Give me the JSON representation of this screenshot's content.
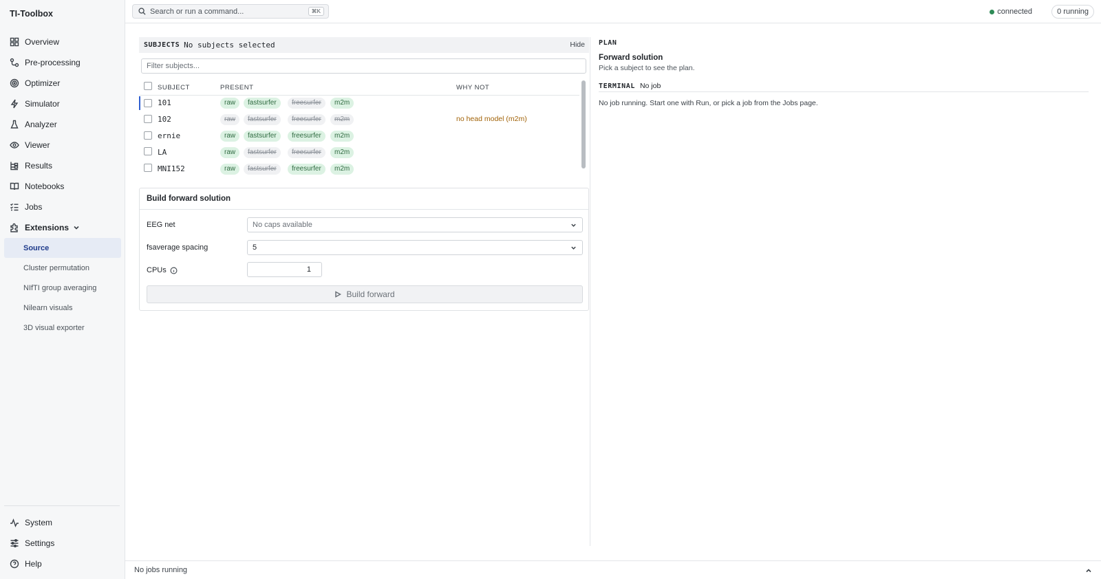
{
  "app": {
    "title": "TI-Toolbox"
  },
  "search": {
    "placeholder": "Search or run a command...",
    "shortcut": "⌘K"
  },
  "status": {
    "connection": "connected",
    "running": "0 running"
  },
  "sidebar": {
    "items": [
      {
        "label": "Overview",
        "icon": "grid-icon"
      },
      {
        "label": "Pre-processing",
        "icon": "workflow-icon"
      },
      {
        "label": "Optimizer",
        "icon": "target-icon"
      },
      {
        "label": "Simulator",
        "icon": "bolt-icon"
      },
      {
        "label": "Analyzer",
        "icon": "flask-icon"
      },
      {
        "label": "Viewer",
        "icon": "eye-icon"
      },
      {
        "label": "Results",
        "icon": "tree-icon"
      },
      {
        "label": "Notebooks",
        "icon": "book-icon"
      },
      {
        "label": "Jobs",
        "icon": "checklist-icon"
      },
      {
        "label": "Extensions",
        "icon": "puzzle-icon"
      }
    ],
    "extensions": [
      "Source",
      "Cluster permutation",
      "NIfTI group averaging",
      "Nilearn visuals",
      "3D visual exporter"
    ],
    "bottom": [
      {
        "label": "System",
        "icon": "activity-icon"
      },
      {
        "label": "Settings",
        "icon": "sliders-icon"
      },
      {
        "label": "Help",
        "icon": "help-circle-icon"
      }
    ]
  },
  "subjects": {
    "label": "SUBJECTS",
    "selection": "No subjects selected",
    "hide": "Hide",
    "filter_placeholder": "Filter subjects...",
    "columns": [
      "SUBJECT",
      "PRESENT",
      "WHY NOT"
    ],
    "rows": [
      {
        "name": "101",
        "raw": true,
        "fastsurfer": true,
        "freesurfer": false,
        "m2m": true,
        "why": ""
      },
      {
        "name": "102",
        "raw": false,
        "fastsurfer": false,
        "freesurfer": false,
        "m2m": false,
        "why": "no head model (m2m)"
      },
      {
        "name": "ernie",
        "raw": true,
        "fastsurfer": true,
        "freesurfer": true,
        "m2m": true,
        "why": ""
      },
      {
        "name": "LA",
        "raw": true,
        "fastsurfer": false,
        "freesurfer": false,
        "m2m": true,
        "why": ""
      },
      {
        "name": "MNI152",
        "raw": true,
        "fastsurfer": false,
        "freesurfer": true,
        "m2m": true,
        "why": ""
      }
    ]
  },
  "chips": {
    "raw": "raw",
    "fastsurfer": "fastsurfer",
    "freesurfer": "freesurfer",
    "m2m": "m2m"
  },
  "build": {
    "title": "Build forward solution",
    "eeg_label": "EEG net",
    "eeg_value": "No caps available",
    "spacing_label": "fsaverage spacing",
    "spacing_value": "5",
    "cpus_label": "CPUs",
    "cpus_value": "1",
    "button": "Build forward"
  },
  "plan": {
    "label": "PLAN",
    "title": "Forward solution",
    "subtitle": "Pick a subject to see the plan.",
    "terminal_label": "TERMINAL",
    "terminal_status": "No job",
    "terminal_message": "No job running. Start one with Run, or pick a job from the Jobs page."
  },
  "footer": {
    "status": "No jobs running"
  }
}
